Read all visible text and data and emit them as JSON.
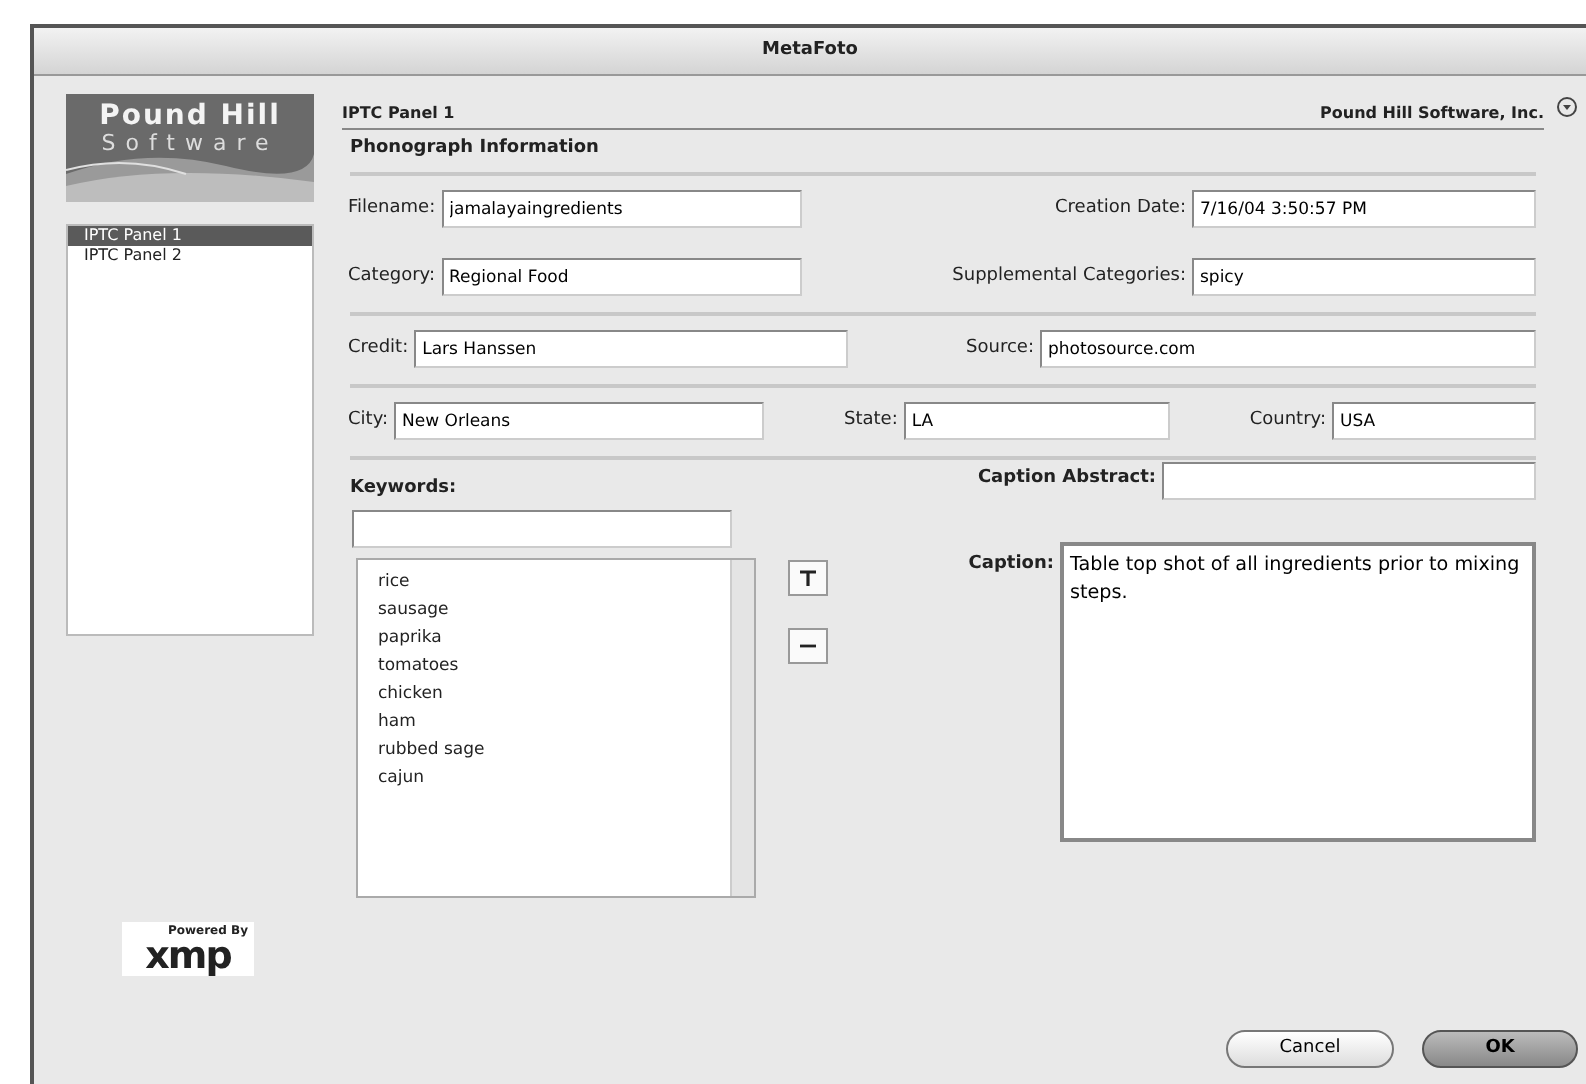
{
  "window": {
    "title": "MetaFoto"
  },
  "logo": {
    "line1": "Pound Hill",
    "line2": "Software"
  },
  "sidebar": {
    "items": [
      {
        "label": "IPTC Panel 1",
        "selected": true
      },
      {
        "label": "IPTC Panel 2",
        "selected": false
      }
    ]
  },
  "powered_by": {
    "caption": "Powered By",
    "brand": "xmp"
  },
  "panel": {
    "title": "IPTC Panel 1",
    "company": "Pound Hill Software, Inc.",
    "section": "Phonograph Information"
  },
  "groups": [
    {
      "rows": [
        [
          {
            "label": "Filename:",
            "value": "jamalayaingredients"
          },
          {
            "label": "Creation Date:",
            "value": "7/16/04 3:50:57 PM"
          }
        ],
        [
          {
            "label": "Category:",
            "value": "Regional Food"
          },
          {
            "label": "Supplemental Categories:",
            "value": "spicy"
          }
        ]
      ]
    },
    {
      "rows": [
        [
          {
            "label": "Credit:",
            "value": "Lars Hanssen"
          },
          {
            "label": "Source:",
            "value": "photosource.com"
          }
        ]
      ]
    },
    {
      "rows": [
        [
          {
            "label": "City:",
            "value": "New Orleans"
          },
          {
            "label": "State:",
            "value": "LA"
          },
          {
            "label": "Country:",
            "value": "USA"
          }
        ]
      ]
    }
  ],
  "keywords": {
    "label": "Keywords:",
    "items": [
      "rice",
      "sausage",
      "paprika",
      "tomatoes",
      "chicken",
      "ham",
      "rubbed sage",
      "cajun"
    ]
  },
  "caption_abstract": {
    "label": "Caption Abstract:"
  },
  "caption": {
    "label": "Caption:",
    "value": "Table top shot of all ingredients prior to mixing steps."
  },
  "buttons": [
    {
      "label": "Cancel",
      "default": false
    },
    {
      "label": "OK",
      "default": true
    }
  ]
}
